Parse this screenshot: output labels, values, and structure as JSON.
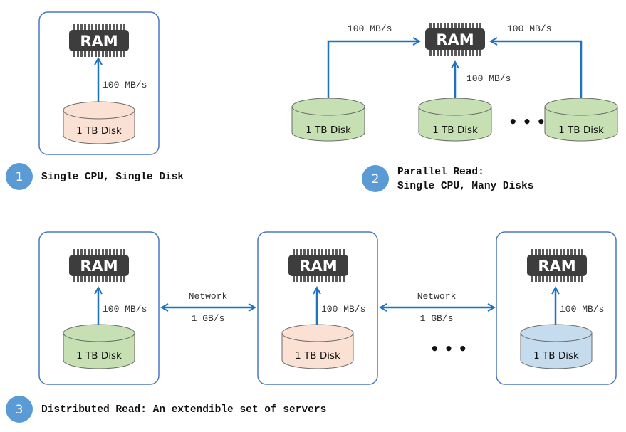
{
  "colors": {
    "arrow": "#1f72c0",
    "server_border": "#4a77c4",
    "badge": "#5b9bd5",
    "ram_body": "#3d3d3d",
    "disk_peach": "#fbe1d3",
    "disk_green": "#c6e0b4",
    "disk_blue": "#c5dcef",
    "disk_stroke": "#6b6b6b"
  },
  "ram_label": "RAM",
  "disk_label": "1 TB Disk",
  "ellipsis": "• • •",
  "section1": {
    "badge": "1",
    "caption": "Single CPU, Single Disk",
    "speed": "100 MB/s"
  },
  "section2": {
    "badge": "2",
    "caption_line1": "Parallel Read:",
    "caption_line2": "Single CPU, Many Disks",
    "speed_left": "100 MB/s",
    "speed_center": "100 MB/s",
    "speed_right": "100 MB/s"
  },
  "section3": {
    "badge": "3",
    "caption": "Distributed Read: An extendible set of servers",
    "server_speed": "100 MB/s",
    "network_label": "Network",
    "network_speed": "1 GB/s"
  }
}
